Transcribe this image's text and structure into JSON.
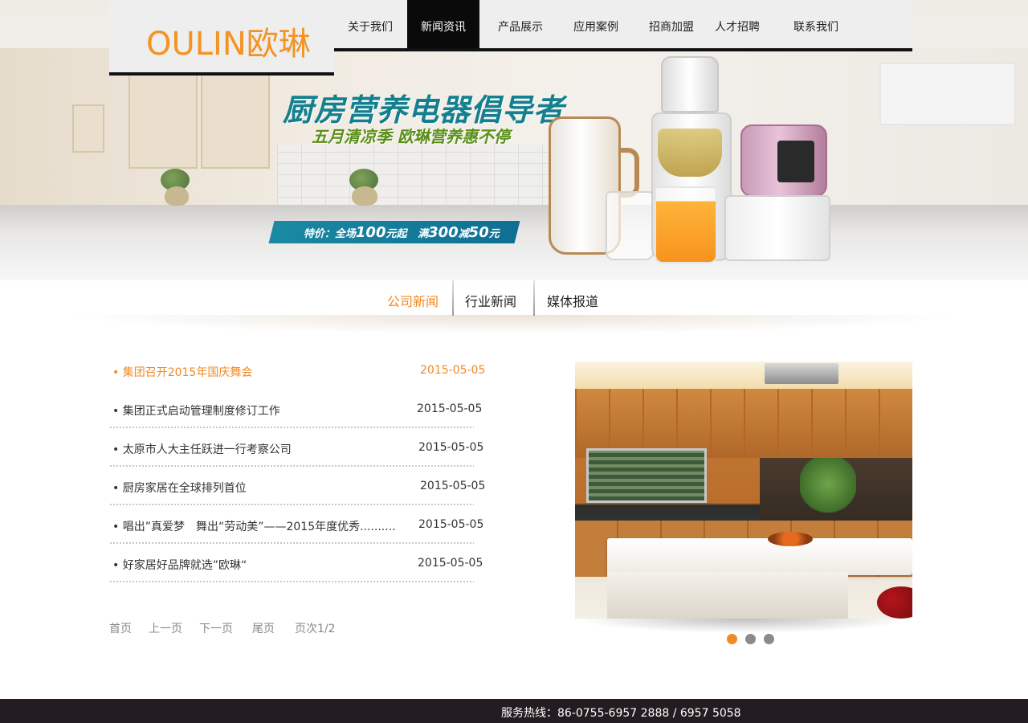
{
  "brand": {
    "logo": "OULIN欧琳",
    "logo_color": "#f39322"
  },
  "nav": {
    "items": [
      {
        "label": "关于我们"
      },
      {
        "label": "新闻资讯",
        "active": true
      },
      {
        "label": "产品展示"
      },
      {
        "label": "应用案例"
      },
      {
        "label": "招商加盟"
      },
      {
        "label": "人才招聘"
      },
      {
        "label": "联系我们"
      }
    ]
  },
  "banner": {
    "headline": "厨房营养电器倡导者",
    "subline": "五月清凉季 欧琳营养惠不停",
    "promo": {
      "prefix": "特价：全场",
      "amount1": "100",
      "unit1": "元起",
      "text2": "满",
      "amount2": "300",
      "text3": "减",
      "amount3": "50",
      "unit3": "元"
    }
  },
  "subtabs": [
    {
      "label": "公司新闻",
      "active": true
    },
    {
      "label": "行业新闻"
    },
    {
      "label": "媒体报道"
    }
  ],
  "news": [
    {
      "title": "• 集团召开2015年国庆舞会",
      "date": "2015-05-05",
      "active": true
    },
    {
      "title": "• 集团正式启动管理制度修订工作",
      "date": "2015-05-05"
    },
    {
      "title": "• 太原市人大主任跃进一行考察公司",
      "date": "2015-05-05"
    },
    {
      "title": "• 厨房家居在全球排列首位",
      "date": "2015-05-05"
    },
    {
      "title": "• 唱出”真爱梦　舞出“劳动美”——2015年度优秀..........",
      "date": "2015-05-05"
    },
    {
      "title": "• 好家居好品牌就选”欧琳“",
      "date": "2015-05-05"
    }
  ],
  "pager": {
    "first": "首页",
    "prev": "上一页",
    "next": "下一页",
    "last": "尾页",
    "page_info": "页次1/2"
  },
  "carousel": {
    "slide_count": 3,
    "active_index": 0,
    "active_color": "#f08a24",
    "inactive_color": "#8b8b8b"
  },
  "footer": {
    "hotline": "服务热线：86-0755-6957 2888 / 6957 5058"
  },
  "colors": {
    "accent": "#f08a24",
    "nav_active_bg": "#0a0a0a",
    "headline": "#14808f",
    "subline": "#5a8f1a",
    "footer_bg": "#231c20"
  }
}
